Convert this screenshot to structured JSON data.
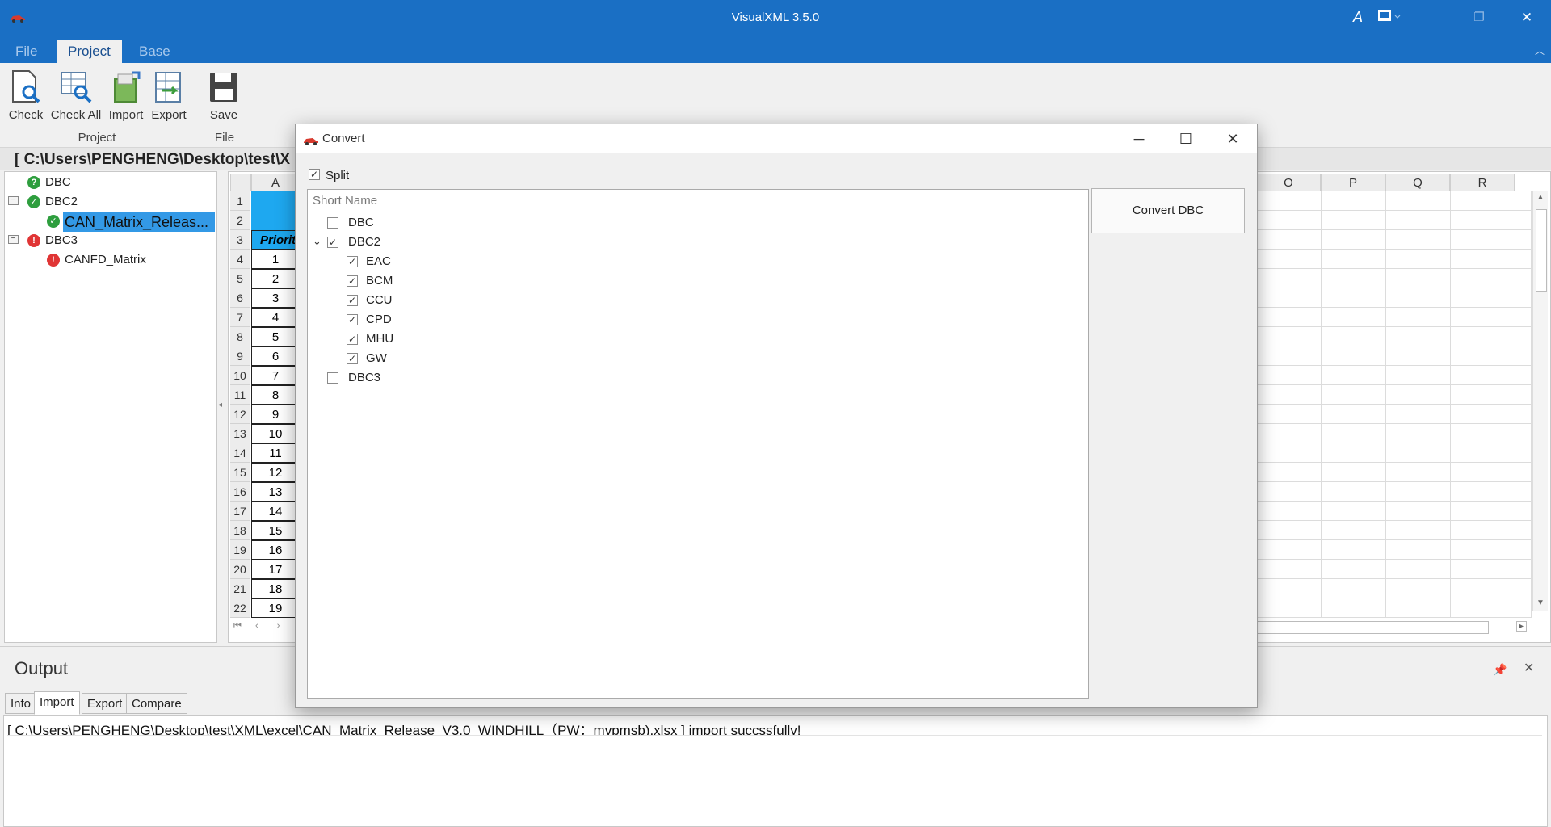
{
  "app": {
    "title": "VisualXML 3.5.0",
    "window_controls": {
      "minimize": "—",
      "restore": "❐",
      "close": "✕"
    }
  },
  "menu": {
    "tabs": [
      "File",
      "Project",
      "Base"
    ],
    "active": "Project"
  },
  "ribbon": {
    "buttons": {
      "check": "Check",
      "check_all": "Check All",
      "import": "Import",
      "export": "Export",
      "save": "Save"
    },
    "groups": {
      "project": "Project",
      "file": "File"
    }
  },
  "path": "[ C:\\Users\\PENGHENG\\Desktop\\test\\X",
  "tree": {
    "nodes": [
      {
        "label": "DBC",
        "status": "unknown"
      },
      {
        "label": "DBC2",
        "status": "ok"
      },
      {
        "label": "CAN_Matrix_Releas...",
        "status": "ok",
        "selected": true
      },
      {
        "label": "DBC3",
        "status": "error"
      },
      {
        "label": "CANFD_Matrix",
        "status": "error"
      }
    ]
  },
  "sheet": {
    "left_columns": [
      "A"
    ],
    "right_columns": [
      "O",
      "P",
      "Q",
      "R"
    ],
    "header_cell": "Priorit",
    "rows": [
      "1",
      "2",
      "3",
      "4",
      "5",
      "6",
      "7",
      "8",
      "9",
      "10",
      "11",
      "12",
      "13",
      "14",
      "15",
      "16",
      "17",
      "18",
      "19",
      "20",
      "21",
      "22"
    ],
    "values": [
      "1",
      "2",
      "3",
      "4",
      "5",
      "6",
      "7",
      "8",
      "9",
      "10",
      "11",
      "12",
      "13",
      "14",
      "15",
      "16",
      "17",
      "18",
      "19"
    ]
  },
  "output": {
    "title": "Output",
    "tabs": [
      "Info",
      "Import",
      "Export",
      "Compare"
    ],
    "active_tab": "Import",
    "log": "[ C:\\Users\\PENGHENG\\Desktop\\test\\XML\\excel\\CAN_Matrix_Release_V3.0_WINDHILL（PW：mypmsb).xlsx ] import succssfully!"
  },
  "dialog": {
    "title": "Convert",
    "split_label": "Split",
    "split_checked": true,
    "list_header": "Short Name",
    "items": [
      {
        "label": "DBC",
        "checked": false,
        "level": 0
      },
      {
        "label": "DBC2",
        "checked": true,
        "level": 0,
        "expanded": true
      },
      {
        "label": "EAC",
        "checked": true,
        "level": 1
      },
      {
        "label": "BCM",
        "checked": true,
        "level": 1
      },
      {
        "label": "CCU",
        "checked": true,
        "level": 1
      },
      {
        "label": "CPD",
        "checked": true,
        "level": 1
      },
      {
        "label": "MHU",
        "checked": true,
        "level": 1
      },
      {
        "label": "GW",
        "checked": true,
        "level": 1
      },
      {
        "label": "DBC3",
        "checked": false,
        "level": 0
      }
    ],
    "convert_button": "Convert DBC"
  },
  "colors": {
    "accent": "#1a6fc4",
    "header_cell": "#1ea8f0",
    "ok": "#2e9e3e",
    "error": "#e03535"
  }
}
